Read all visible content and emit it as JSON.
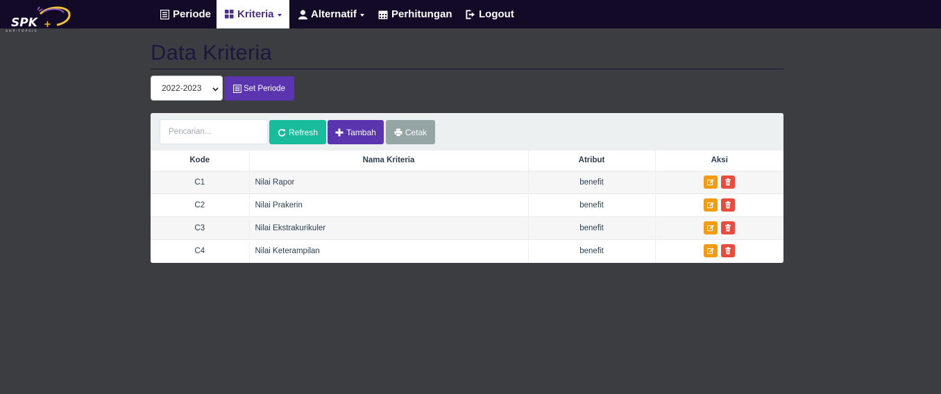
{
  "brand": {
    "logo_text": "SPK",
    "logo_subtitle": "AHP-TOPSIS"
  },
  "nav": [
    {
      "label": "Periode",
      "icon": "list-icon",
      "active": false,
      "dropdown": false
    },
    {
      "label": "Kriteria",
      "icon": "grid-icon",
      "active": true,
      "dropdown": true
    },
    {
      "label": "Alternatif",
      "icon": "user-icon",
      "active": false,
      "dropdown": true
    },
    {
      "label": "Perhitungan",
      "icon": "calendar-icon",
      "active": false,
      "dropdown": false
    },
    {
      "label": "Logout",
      "icon": "logout-icon",
      "active": false,
      "dropdown": false
    }
  ],
  "page": {
    "title": "Data Kriteria"
  },
  "periode": {
    "selected": "2022-2023",
    "set_label": "Set Periode"
  },
  "toolbar": {
    "search_placeholder": "Pencarian...",
    "refresh_label": "Refresh",
    "tambah_label": "Tambah",
    "cetak_label": "Cetak"
  },
  "table": {
    "headers": [
      "Kode",
      "Nama Kriteria",
      "Atribut",
      "Aksi"
    ],
    "rows": [
      {
        "kode": "C1",
        "nama": "Nilai Rapor",
        "atribut": "benefit"
      },
      {
        "kode": "C2",
        "nama": "Nilai Prakerin",
        "atribut": "benefit"
      },
      {
        "kode": "C3",
        "nama": "Nilai Ekstrakurikuler",
        "atribut": "benefit"
      },
      {
        "kode": "C4",
        "nama": "Nilai Keterampilan",
        "atribut": "benefit"
      }
    ]
  },
  "colors": {
    "navbar": "#120a26",
    "primary": "#5b35b0",
    "success": "#18bc9c",
    "muted": "#95a5a6",
    "warning": "#f39c12",
    "danger": "#e74c3c",
    "background": "#3c3d40"
  }
}
